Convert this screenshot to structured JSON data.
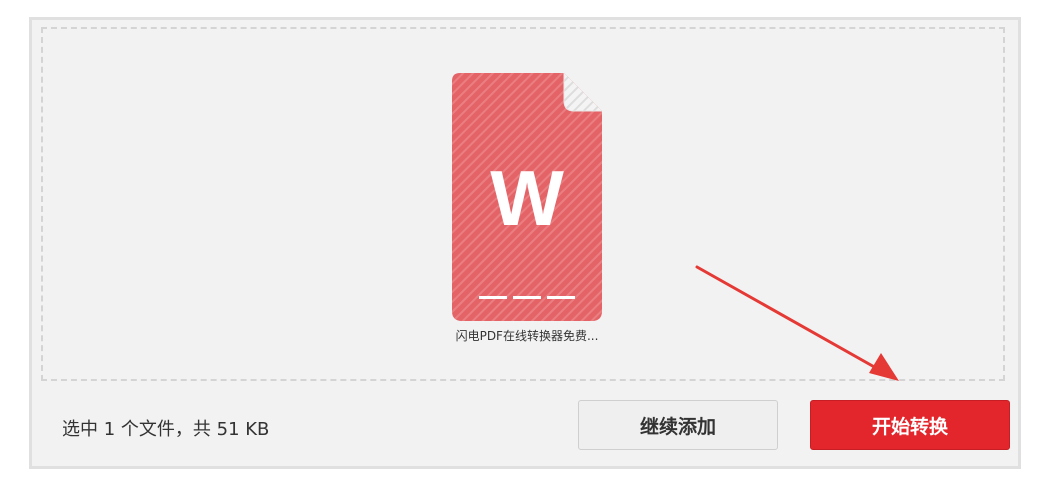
{
  "file": {
    "icon": "word-document-icon",
    "letter": "W",
    "name": "闪电PDF在线转换器免费...",
    "color": "#e46367"
  },
  "status": {
    "text": "选中 1 个文件，共 51 KB"
  },
  "buttons": {
    "add_label": "继续添加",
    "start_label": "开始转换"
  },
  "colors": {
    "accent": "#e2262c",
    "arrow": "#e53935"
  }
}
